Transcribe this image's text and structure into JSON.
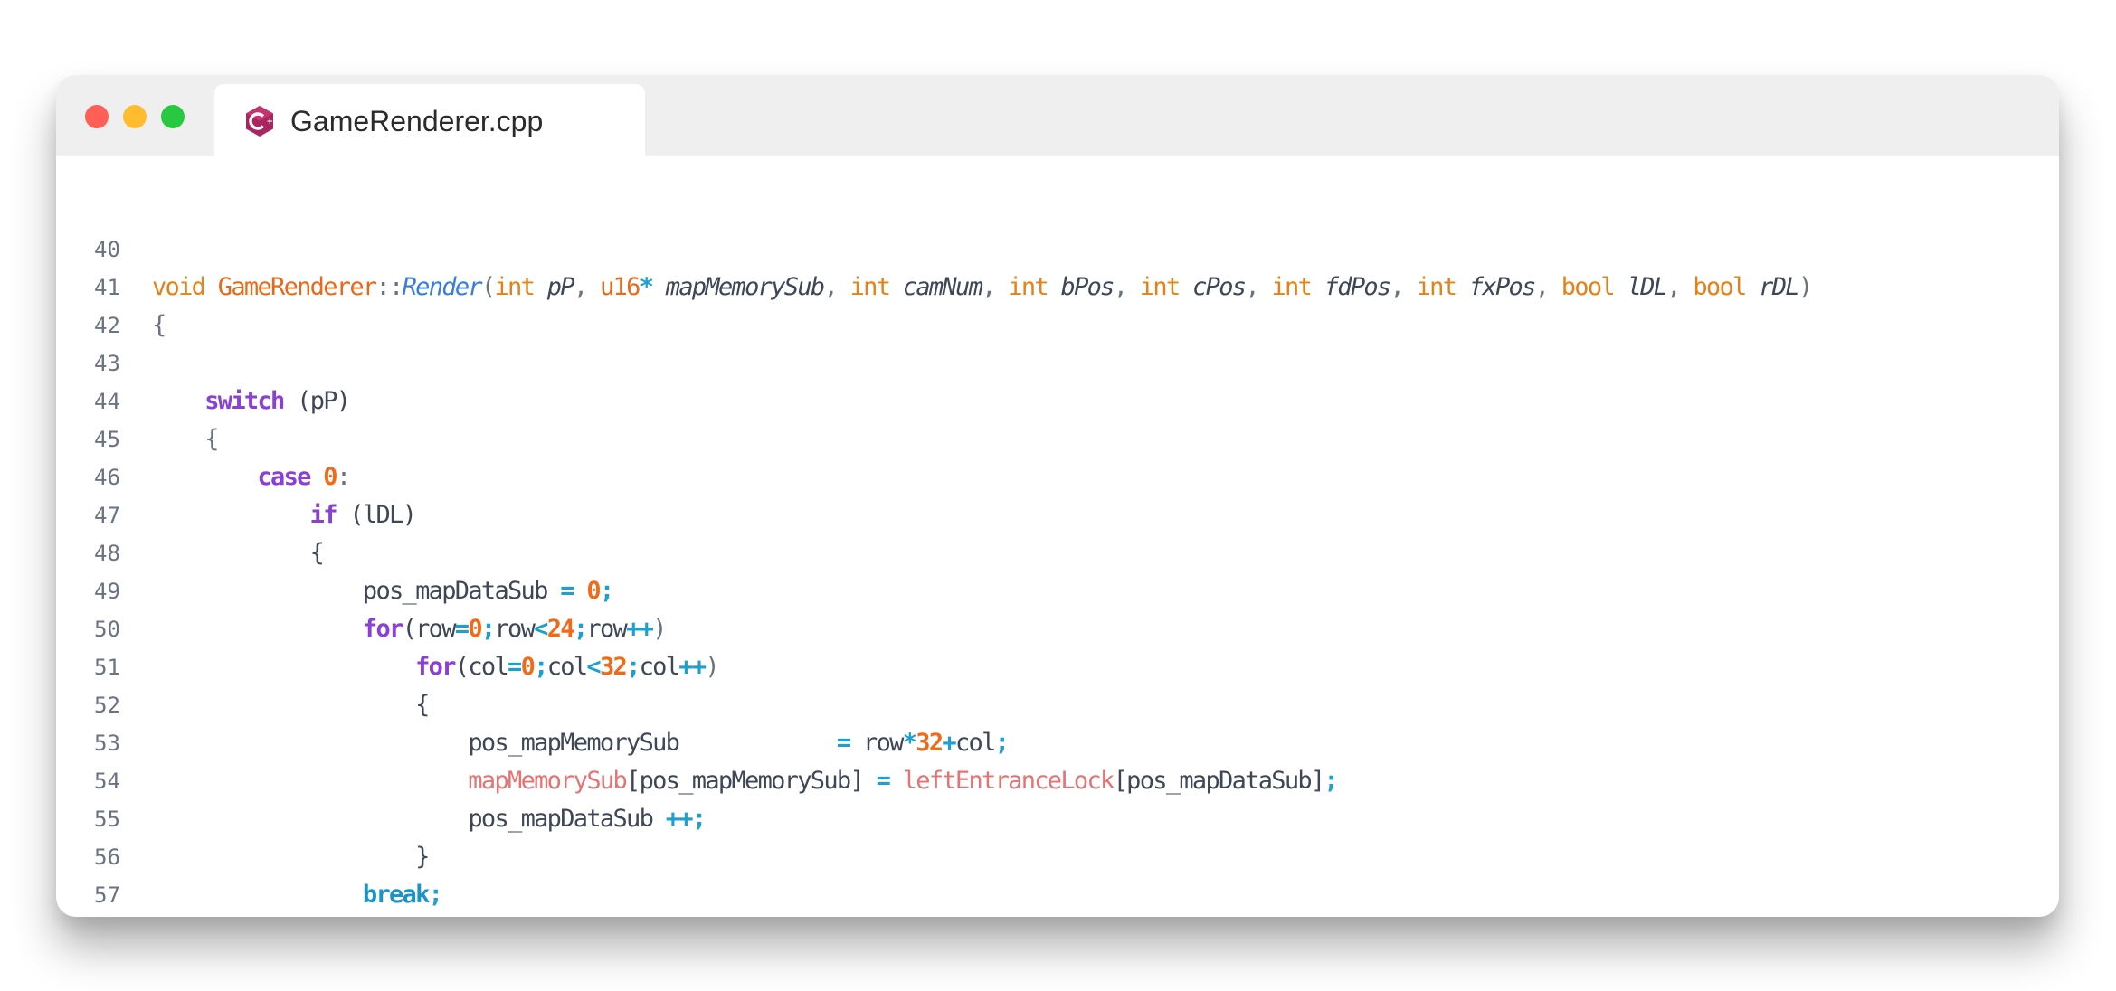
{
  "window": {
    "tab_title": "GameRenderer.cpp",
    "tab_icon": "cpp-file-icon"
  },
  "code": {
    "lines": [
      {
        "number": "40"
      },
      {
        "number": "41"
      },
      {
        "number": "42"
      },
      {
        "number": "43"
      },
      {
        "number": "44"
      },
      {
        "number": "45"
      },
      {
        "number": "46"
      },
      {
        "number": "47"
      },
      {
        "number": "48"
      },
      {
        "number": "49"
      },
      {
        "number": "50"
      },
      {
        "number": "51"
      },
      {
        "number": "52"
      },
      {
        "number": "53"
      },
      {
        "number": "54"
      },
      {
        "number": "55"
      },
      {
        "number": "56"
      },
      {
        "number": "57"
      }
    ],
    "tokens": {
      "l40": {
        "void": "void",
        "class": "GameRenderer",
        "scope": "::",
        "method": "Render",
        "open": "(",
        "t1": "int",
        "p1": "pP",
        "t2": "u16",
        "star": "*",
        "p2": "mapMemorySub",
        "t3": "int",
        "p3": "camNum",
        "t4": "int",
        "p4": "bPos",
        "t5": "int",
        "p5": "cPos",
        "t6": "int",
        "p6": "fdPos",
        "t7": "int",
        "p7": "fxPos",
        "t8": "bool",
        "p8": "lDL",
        "t9": "bool",
        "p9": "rDL",
        "comma": ",",
        "close": ")"
      },
      "l41": {
        "brace": "{"
      },
      "l43": {
        "kw": "switch",
        "rest": " (pP)"
      },
      "l44": {
        "brace": "{"
      },
      "l45": {
        "kw": "case",
        "num": "0",
        "colon": ":"
      },
      "l46": {
        "kw": "if",
        "rest": " (lDL)"
      },
      "l47": {
        "brace": "{"
      },
      "l48": {
        "var": "pos_mapDataSub",
        "eq": "=",
        "num": "0",
        "semi": ";"
      },
      "l49": {
        "kw": "for",
        "a": "(row",
        "eq": "=",
        "n0": "0",
        "s1": ";",
        "b": "row",
        "lt": "<",
        "n1": "24",
        "s2": ";",
        "c": "row",
        "inc": "++",
        "close": ")"
      },
      "l50": {
        "kw": "for",
        "a": "(col",
        "eq": "=",
        "n0": "0",
        "s1": ";",
        "b": "col",
        "lt": "<",
        "n1": "32",
        "s2": ";",
        "c": "col",
        "inc": "++",
        "close": ")"
      },
      "l51": {
        "brace": "{"
      },
      "l52": {
        "var": "pos_mapMemorySub",
        "eq": "=",
        "a": "row",
        "mul": "*",
        "n": "32",
        "plus": "+",
        "b": "col",
        "semi": ";"
      },
      "l53": {
        "arr1": "mapMemorySub",
        "idx1": "[pos_mapMemorySub]",
        "eq": "=",
        "arr2": "leftEntranceLock",
        "idx2": "[pos_mapDataSub]",
        "semi": ";"
      },
      "l54": {
        "var": "pos_mapDataSub",
        "inc": "++",
        "semi": ";"
      },
      "l55": {
        "brace": "}"
      },
      "l56": {
        "kw": "break",
        "semi": ";"
      },
      "l57": {
        "brace": "}"
      }
    }
  },
  "colors": {
    "keyword": "#8a3fd6",
    "type": "#e3821a",
    "number": "#f06a1a",
    "operator": "#1ba0cf",
    "array": "#e57373",
    "function": "#3b7ed8"
  }
}
